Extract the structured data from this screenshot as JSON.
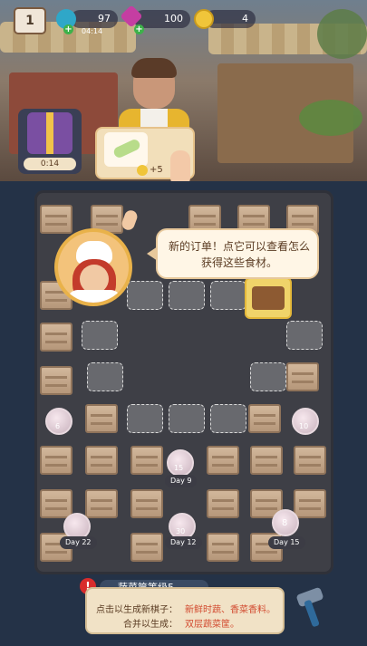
{
  "hud": {
    "level": "1",
    "energy": "97",
    "energy_timer": "04:14",
    "gems": "100",
    "coins": "4"
  },
  "shop": {
    "timer": "0:14"
  },
  "order": {
    "reward": "+5"
  },
  "dialog": {
    "text": "新的订单！点它可以查看怎么获得这些食材。"
  },
  "board": {
    "tags": [
      "Day 9",
      "Day 22",
      "Day 12",
      "Day 15"
    ],
    "bubble_counts": [
      "6",
      "10",
      "15",
      "30",
      "8"
    ]
  },
  "info_panel": {
    "title": "蔬菜筐等级5",
    "line1_label": "点击以生成新棋子：",
    "line1_value": "新鲜时蔬、香菜香料。",
    "line2_label": "合并以生成：",
    "line2_value": "双层蔬菜筐。"
  },
  "colors": {
    "accent_green": "#3db24a",
    "warning_red": "#d82c2c",
    "panel_bg": "#f1e2c6"
  },
  "icons": [
    "calendar-icon",
    "energy-icon",
    "gem-icon",
    "coin-icon",
    "gift-box-icon",
    "hammer-icon",
    "leek-icon",
    "hand-pointer-icon"
  ]
}
